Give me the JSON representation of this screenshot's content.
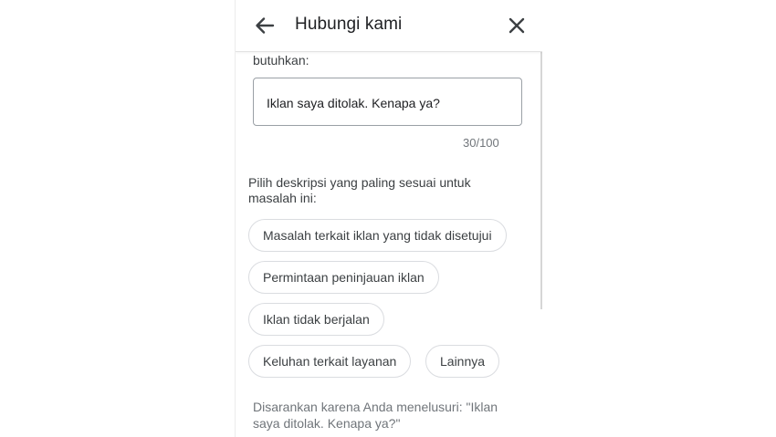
{
  "header": {
    "title": "Hubungi kami",
    "back_icon": "arrow-back-icon",
    "close_icon": "close-icon"
  },
  "form": {
    "clipped_label": "butuhkan:",
    "input_value": "Iklan saya ditolak. Kenapa ya?",
    "char_counter": "30/100"
  },
  "description": {
    "prompt": "Pilih deskripsi yang paling sesuai untuk masalah ini:",
    "chips": [
      "Masalah terkait iklan yang tidak disetujui",
      "Permintaan peninjauan iklan",
      "Iklan tidak berjalan",
      "Keluhan terkait layanan",
      "Lainnya"
    ]
  },
  "footer": {
    "suggestion": "Disarankan karena Anda menelusuri: \"Iklan saya ditolak. Kenapa ya?\""
  },
  "colors": {
    "text_primary": "#202124",
    "text_secondary": "#3c4043",
    "text_muted": "#70757a",
    "chip_border": "#dadce0",
    "field_border": "#9aa0a6"
  }
}
